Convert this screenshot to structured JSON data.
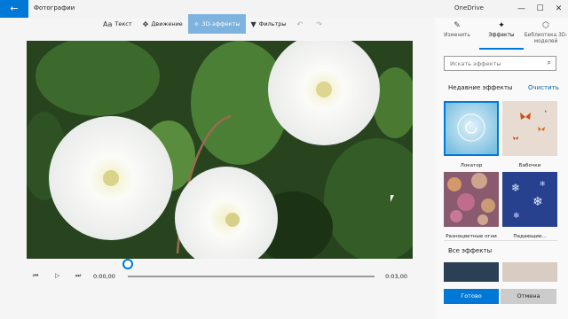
{
  "app": {
    "title": "Фотографии",
    "back_icon": "arrow-left-icon"
  },
  "onedrive": {
    "title": "OneDrive"
  },
  "window_controls": {
    "minimize": "—",
    "maximize": "☐",
    "close": "✕"
  },
  "toolbar": {
    "text": "Текст",
    "motion": "Движение",
    "effects3d": "3D-эффекты",
    "filters": "Фильтры",
    "accent": "#7fb3df"
  },
  "playback": {
    "time_start": "0:00,00",
    "time_end": "0:03,00",
    "progress": 0.0
  },
  "panel": {
    "tabs": [
      {
        "label": "Изменить",
        "icon": "pencil-icon"
      },
      {
        "label": "Эффекты",
        "icon": "sparkle-icon"
      },
      {
        "label": "Библиотека 3D-моделей",
        "icon": "cube-icon"
      }
    ],
    "active_tab": 1,
    "search_placeholder": "Искать эффекты",
    "recent_heading": "Недавние эффекты",
    "clear_link": "Очистить",
    "all_heading": "Все эффекты",
    "recent_effects": [
      {
        "label": "Локатор"
      },
      {
        "label": "Бабочки"
      },
      {
        "label": "Разноцветные огни"
      },
      {
        "label": "Падающие..."
      }
    ],
    "ok_label": "Готово",
    "cancel_label": "Отмена",
    "accent": "#0078d7"
  }
}
